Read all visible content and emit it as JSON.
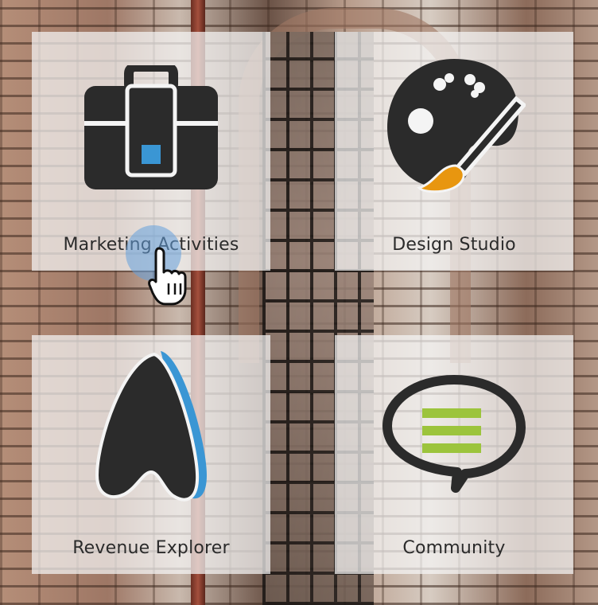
{
  "tiles": [
    {
      "id": "marketing",
      "label": "Marketing Activities",
      "icon": "briefcase-icon"
    },
    {
      "id": "design",
      "label": "Design Studio",
      "icon": "palette-icon"
    },
    {
      "id": "revenue",
      "label": "Revenue Explorer",
      "icon": "revenue-explorer-icon"
    },
    {
      "id": "community",
      "label": "Community",
      "icon": "speech-bubble-icon"
    }
  ],
  "colors": {
    "icon_dark": "#2b2b2b",
    "blue_accent": "#3a96d4",
    "orange_accent": "#e8960f",
    "green_accent": "#9cc43c",
    "tile_bg": "rgba(245,245,245,0.72)"
  },
  "cursor": {
    "icon": "hand-pointer-icon"
  }
}
